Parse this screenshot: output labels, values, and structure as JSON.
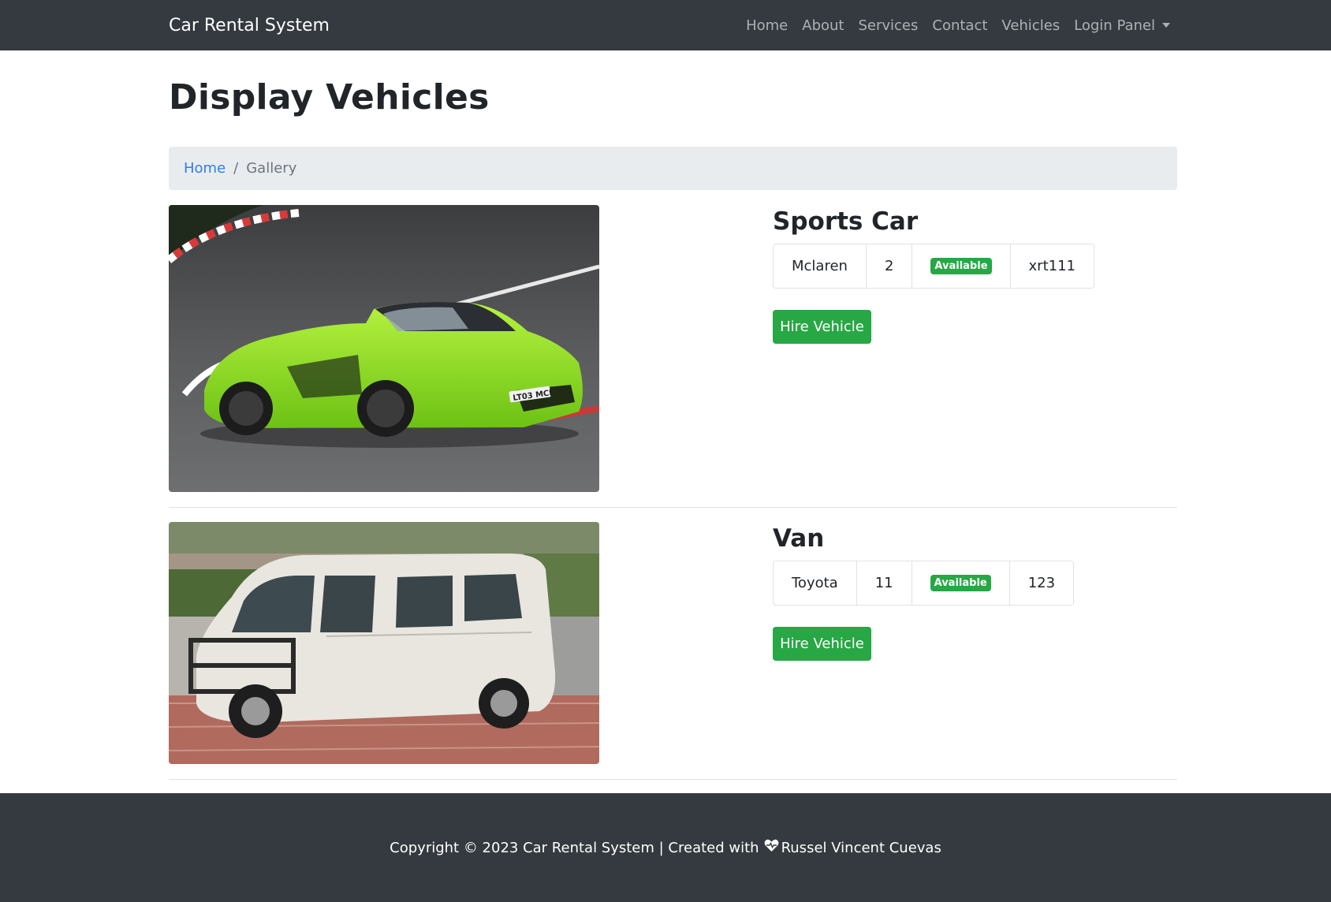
{
  "navbar": {
    "brand": "Car Rental System",
    "links": [
      "Home",
      "About",
      "Services",
      "Contact",
      "Vehicles",
      "Login Panel"
    ]
  },
  "page_title": "Display Vehicles",
  "breadcrumb": {
    "home": "Home",
    "separator": "/",
    "current": "Gallery"
  },
  "vehicles": [
    {
      "name": "Sports Car",
      "make": "Mclaren",
      "seats": "2",
      "status": "Available",
      "plate": "xrt111",
      "hire_label": "Hire Vehicle",
      "photo_plate_text": "LT03 MCL"
    },
    {
      "name": "Van",
      "make": "Toyota",
      "seats": "11",
      "status": "Available",
      "plate": "123",
      "hire_label": "Hire Vehicle"
    }
  ],
  "footer": {
    "copyright": "Copyright © 2023 Car Rental System | Created with",
    "author": "Russel Vincent Cuevas"
  },
  "colors": {
    "navbar": "#343a40",
    "success": "#28a745",
    "link": "#2f7fe0",
    "breadcrumb_bg": "#e9ecef"
  }
}
